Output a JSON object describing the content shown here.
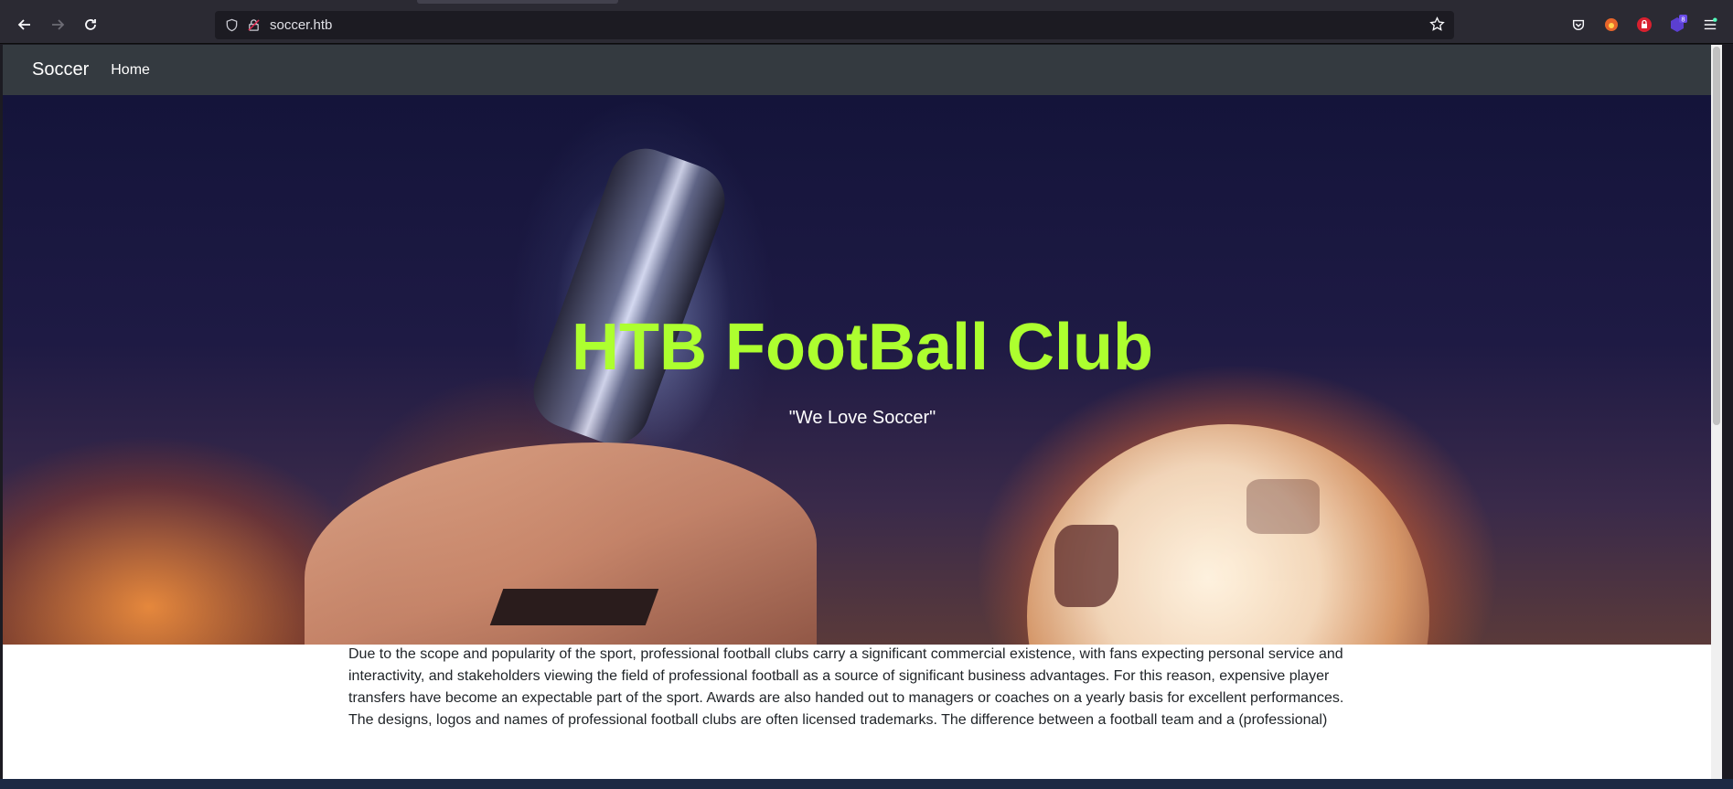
{
  "browser": {
    "url": "soccer.htb",
    "extension_badge": "8"
  },
  "site": {
    "brand": "Soccer",
    "nav_home": "Home"
  },
  "hero": {
    "title": "HTB FootBall Club",
    "subtitle": "\"We Love Soccer\"",
    "title_color": "#adff2f"
  },
  "content": {
    "paragraph": "Due to the scope and popularity of the sport, professional football clubs carry a significant commercial existence, with fans expecting personal service and interactivity, and stakeholders viewing the field of professional football as a source of significant business advantages. For this reason, expensive player transfers have become an expectable part of the sport. Awards are also handed out to managers or coaches on a yearly basis for excellent performances. The designs, logos and names of professional football clubs are often licensed trademarks. The difference between a football team and a (professional)"
  },
  "icons": {
    "back": "arrow-left-icon",
    "forward": "arrow-right-icon",
    "reload": "reload-icon",
    "shield": "shield-icon",
    "lock": "insecure-lock-icon",
    "bookmark": "star-icon",
    "pocket": "pocket-icon",
    "menu": "hamburger-menu-icon"
  }
}
